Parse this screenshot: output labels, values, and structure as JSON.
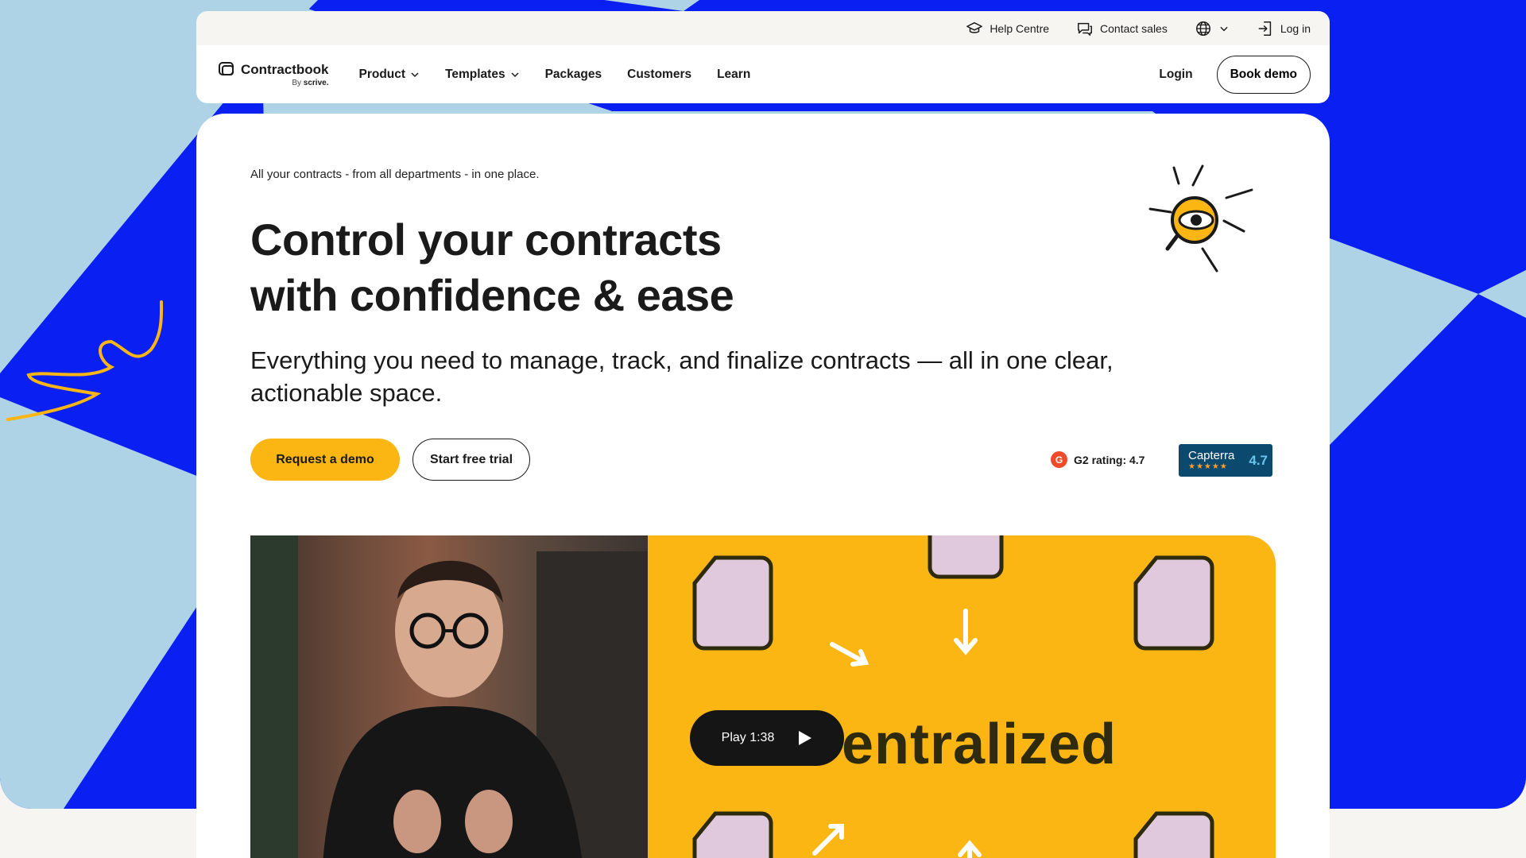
{
  "colors": {
    "accent_yellow": "#fbb613",
    "background_blue": "#0a1ff2",
    "background_light_blue": "#aed3e6",
    "dark": "#1a1a1a",
    "capterra_bg": "#0b4a6e",
    "g2_red": "#ef4a2b"
  },
  "utility_bar": {
    "help": {
      "label": "Help Centre",
      "icon": "graduation-cap-icon"
    },
    "contact": {
      "label": "Contact sales",
      "icon": "chat-bubble-icon"
    },
    "language": {
      "icon": "globe-icon"
    },
    "login": {
      "label": "Log in",
      "icon": "login-door-icon"
    }
  },
  "nav": {
    "logo_name": "Contractbook",
    "logo_by": "By",
    "logo_parent": "scrive.",
    "links": [
      {
        "label": "Product",
        "dropdown": true
      },
      {
        "label": "Templates",
        "dropdown": true
      },
      {
        "label": "Packages",
        "dropdown": false
      },
      {
        "label": "Customers",
        "dropdown": false
      },
      {
        "label": "Learn",
        "dropdown": false
      }
    ],
    "login": "Login",
    "book_demo": "Book demo"
  },
  "hero": {
    "eyebrow": "All your contracts - from all departments - in one place.",
    "headline_line1": "Control your contracts",
    "headline_line2": "with confidence & ease",
    "subhead": "Everything you need to manage, track, and finalize contracts — all in one clear, actionable space.",
    "cta_primary": "Request a demo",
    "cta_secondary": "Start free trial",
    "g2_label": "G2 rating: 4.7",
    "g2_logo": "G",
    "capterra_name": "Capterra",
    "capterra_stars": "★★★★★",
    "capterra_score": "4.7"
  },
  "video": {
    "play_label": "Play 1:38",
    "overlay_word": "entralized"
  }
}
